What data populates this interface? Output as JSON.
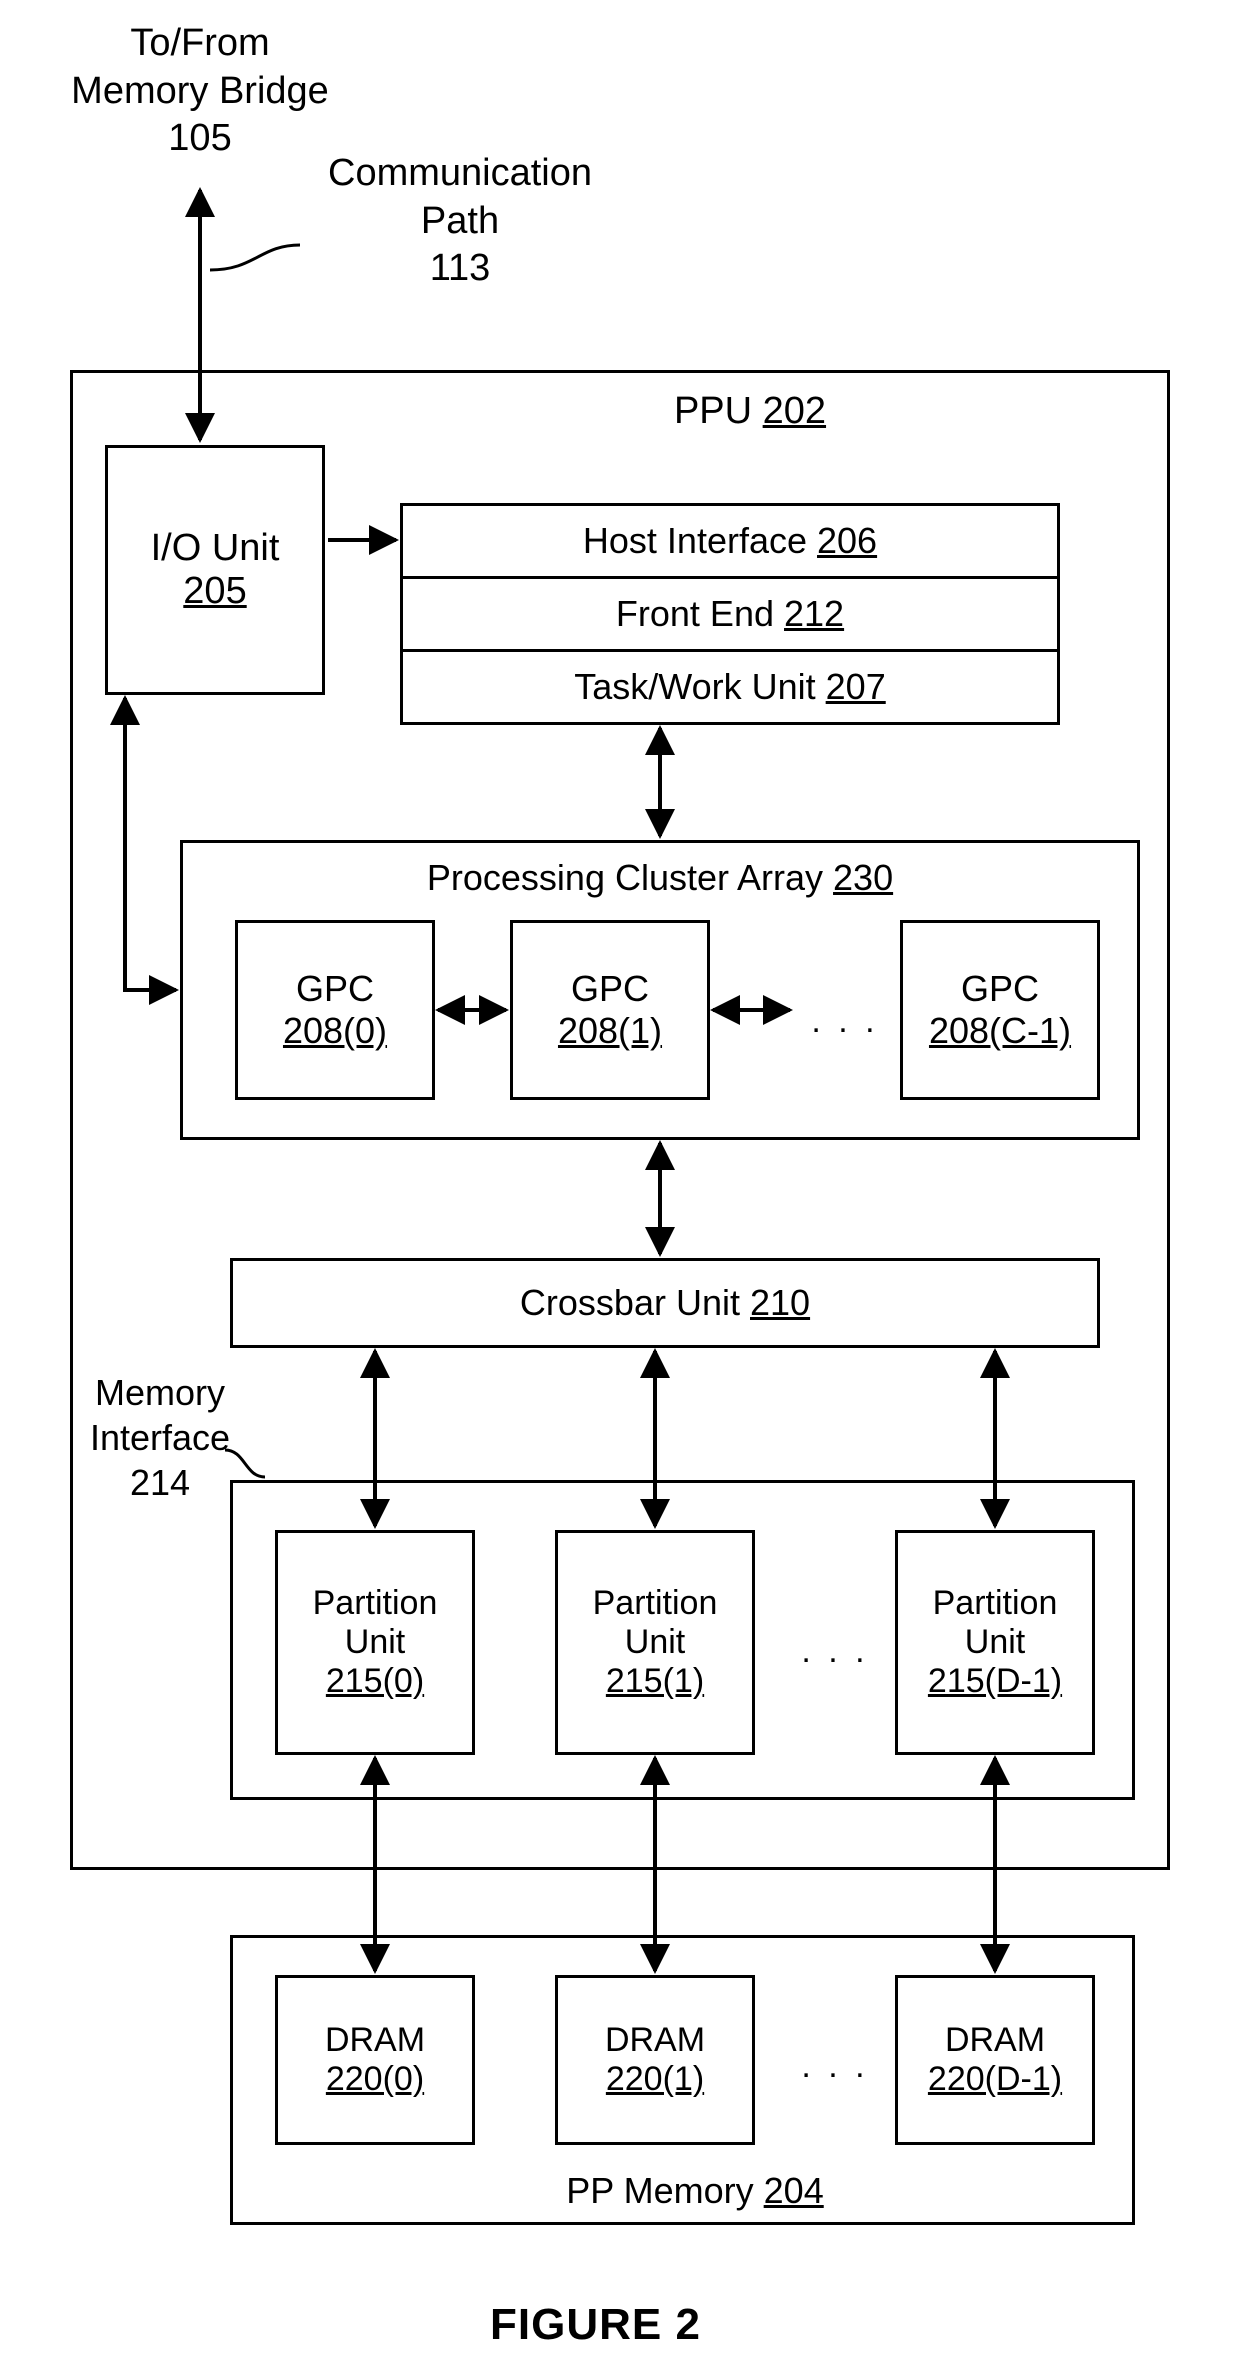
{
  "external": {
    "mem_bridge_l1": "To/From",
    "mem_bridge_l2": "Memory Bridge",
    "mem_bridge_ref": "105",
    "comm_path_l1": "Communication",
    "comm_path_l2": "Path",
    "comm_path_ref": "113"
  },
  "ppu": {
    "label": "PPU",
    "ref": "202",
    "io_unit": {
      "label": "I/O Unit",
      "ref": "205"
    },
    "host_if": {
      "label": "Host Interface",
      "ref": "206"
    },
    "front_end": {
      "label": "Front End",
      "ref": "212"
    },
    "task_unit": {
      "label": "Task/Work Unit",
      "ref": "207"
    },
    "pca": {
      "label": "Processing Cluster Array",
      "ref": "230",
      "gpc": [
        {
          "label": "GPC",
          "ref": "208(0)"
        },
        {
          "label": "GPC",
          "ref": "208(1)"
        },
        {
          "label": "GPC",
          "ref": "208(C-1)"
        }
      ],
      "ellipsis": ". . ."
    },
    "crossbar": {
      "label": "Crossbar Unit",
      "ref": "210"
    },
    "mem_if": {
      "l1": "Memory",
      "l2": "Interface",
      "ref": "214"
    },
    "partitions": [
      {
        "l1": "Partition",
        "l2": "Unit",
        "ref": "215(0)"
      },
      {
        "l1": "Partition",
        "l2": "Unit",
        "ref": "215(1)"
      },
      {
        "l1": "Partition",
        "l2": "Unit",
        "ref": "215(D-1)"
      }
    ],
    "part_ellipsis": ". . ."
  },
  "ppmem": {
    "label": "PP Memory",
    "ref": "204",
    "dram": [
      {
        "label": "DRAM",
        "ref": "220(0)"
      },
      {
        "label": "DRAM",
        "ref": "220(1)"
      },
      {
        "label": "DRAM",
        "ref": "220(D-1)"
      }
    ],
    "ellipsis": ". . ."
  },
  "figure": "FIGURE 2"
}
